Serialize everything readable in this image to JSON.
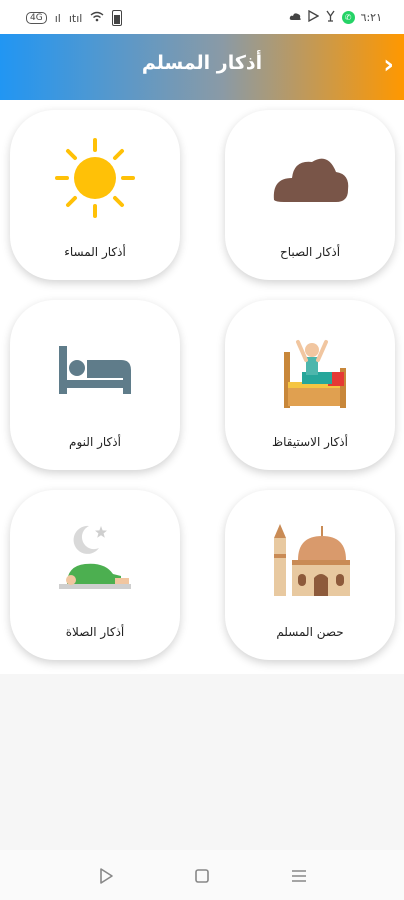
{
  "status_bar": {
    "left_text": "4G",
    "signal": "ıl",
    "data_text": "ıtıl",
    "time": "٦:٢١"
  },
  "header": {
    "title": "أذكار المسلم",
    "back_icon": "chevron-icon"
  },
  "cards": [
    {
      "label": "أذكار الصباح",
      "icon": "cloud-icon"
    },
    {
      "label": "أذكار المساء",
      "icon": "sun-icon"
    },
    {
      "label": "أذكار الاستيقاظ",
      "icon": "wake-up-bed-icon"
    },
    {
      "label": "أذكار النوم",
      "icon": "bed-icon"
    },
    {
      "label": "حصن المسلم",
      "icon": "mosque-icon"
    },
    {
      "label": "أذكار الصلاة",
      "icon": "prayer-icon"
    }
  ],
  "colors": {
    "header_start": "#2196f3",
    "header_end": "#ff9800",
    "sun": "#ffc107",
    "cloud": "#795548",
    "bed": "#5f7c8a"
  },
  "nav": {
    "items": [
      "back-icon",
      "home-icon",
      "menu-icon"
    ]
  }
}
